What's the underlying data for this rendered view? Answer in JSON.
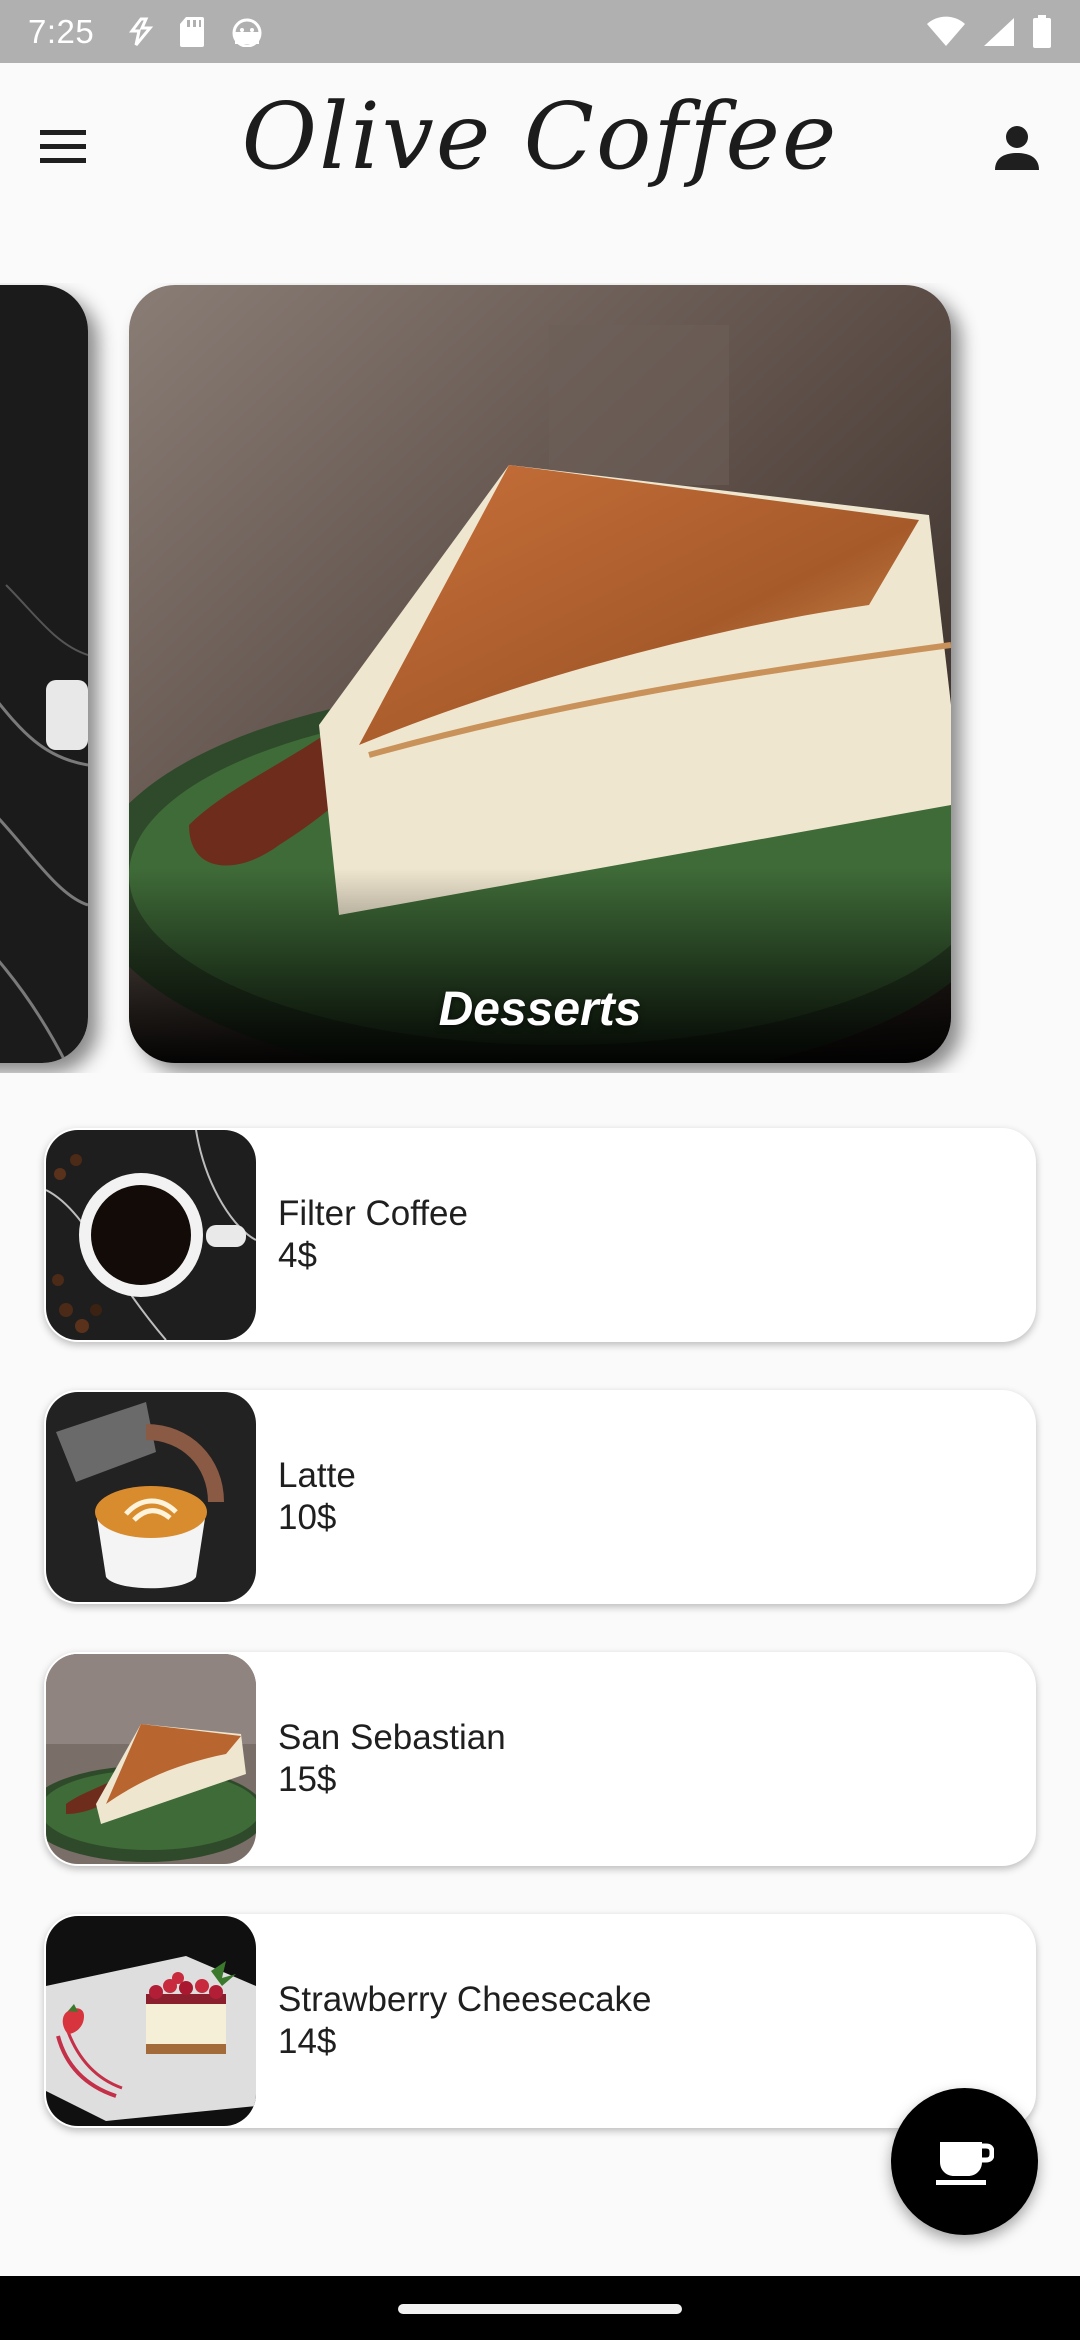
{
  "status_bar": {
    "time": "7:25",
    "left_icons": [
      "data-saver-icon",
      "sd-card-icon",
      "android-head-icon"
    ],
    "right_icons": [
      "wifi-icon",
      "signal-icon",
      "battery-icon"
    ]
  },
  "app_bar": {
    "title": "Olive Coffee",
    "menu_icon": "hamburger-menu-icon",
    "profile_icon": "person-icon"
  },
  "carousel": {
    "current_category": "Desserts"
  },
  "products": [
    {
      "name": "Filter Coffee",
      "price": "4$"
    },
    {
      "name": "Latte",
      "price": "10$"
    },
    {
      "name": "San Sebastian",
      "price": "15$"
    },
    {
      "name": "Strawberry Cheesecake",
      "price": "14$"
    }
  ],
  "fab": {
    "icon": "coffee-cup-icon"
  },
  "colors": {
    "background": "#fafafa",
    "status_bar": "#b0b0b0",
    "fab": "#000000",
    "card": "#ffffff"
  }
}
